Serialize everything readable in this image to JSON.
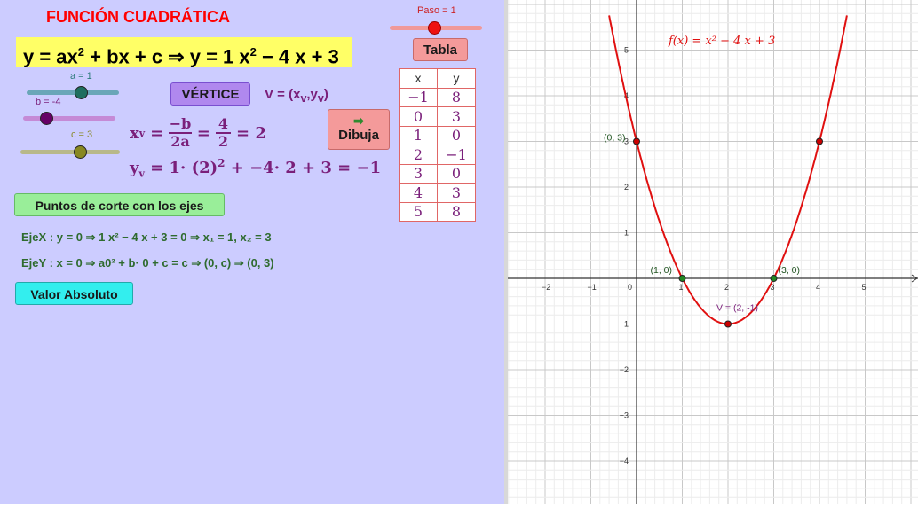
{
  "title": "FUNCIÓN CUADRÁTICA",
  "equation": {
    "prefix": "y = ax",
    "mid1": " + bx + c ⇒ y = 1 x",
    "mid2": " − 4 x + 3",
    "sup": "2"
  },
  "sliders": {
    "paso": {
      "label": "Paso = 1",
      "value": 1
    },
    "a": {
      "label": "a = 1",
      "value": 1
    },
    "b": {
      "label": "b = -4",
      "value": -4
    },
    "c": {
      "label": "c = 3",
      "value": 3
    }
  },
  "buttons": {
    "tabla": "Tabla",
    "vertice": "VÉRTICE",
    "dibuja": "Dibuja",
    "puntos": "Puntos de corte con los ejes",
    "valor_absoluto": "Valor Absoluto"
  },
  "vertex_label": "V = (x",
  "xv": {
    "lhs": "x",
    "num1": "−b",
    "den1": "2a",
    "num2": "4",
    "den2": "2",
    "result": "= 2"
  },
  "yv": {
    "text": "= 1· (2)",
    "rest": " + −4· 2 + 3 = −1"
  },
  "ejes": {
    "ejex_lbl": "EjeX",
    "ejex": " : y = 0 ⇒ 1 x² − 4 x + 3 = 0 ⇒ x₁ = 1, x₂ = 3",
    "ejey_lbl": "EjeY",
    "ejey": " : x = 0 ⇒ a0² + b· 0 + c = c ⇒ (0, c) ⇒ (0, 3)"
  },
  "table": {
    "headers": [
      "x",
      "y"
    ],
    "rows": [
      [
        "−1",
        "8"
      ],
      [
        "0",
        "3"
      ],
      [
        "1",
        "0"
      ],
      [
        "2",
        "−1"
      ],
      [
        "3",
        "0"
      ],
      [
        "4",
        "3"
      ],
      [
        "5",
        "8"
      ]
    ]
  },
  "graph": {
    "function_label": "f(x) = x² − 4 x + 3",
    "x_ticks": [
      "−2",
      "−1",
      "0",
      "1",
      "2",
      "3",
      "4",
      "5"
    ],
    "y_ticks": [
      "5",
      "4",
      "3",
      "2",
      "1",
      "−1",
      "−2",
      "−3",
      "−4"
    ],
    "points": [
      {
        "label": "(0, 3)",
        "x": 0,
        "y": 3,
        "color": "#cc0000"
      },
      {
        "label": "(1, 0)",
        "x": 1,
        "y": 0,
        "color": "#228822"
      },
      {
        "label": "(3, 0)",
        "x": 3,
        "y": 0,
        "color": "#228822"
      },
      {
        "label": "V = (2, -1)",
        "x": 2,
        "y": -1,
        "color": "#cc0000"
      },
      {
        "label": "",
        "x": 4,
        "y": 3,
        "color": "#cc0000"
      }
    ]
  },
  "colors": {
    "curve": "#e01010",
    "panel": "#ccccff",
    "title": "#ff0000",
    "highlight": "#ffff66"
  }
}
